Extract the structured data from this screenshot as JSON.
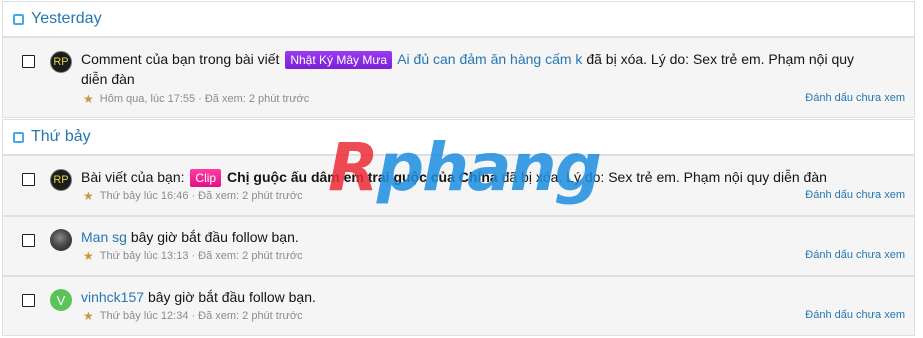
{
  "sections": [
    {
      "title": "Yesterday",
      "alerts": [
        {
          "avatar": "RP",
          "avatar_type": "rp",
          "prefix": "Comment của bạn trong bài viết",
          "label": "Nhật Ký Mây Mưa",
          "label_style": "purple",
          "thread_title": "Ai đủ can đảm ăn hàng cấm k",
          "suffix": "đã bị xóa. Lý do: Sex trẻ em. Phạm nội quy diễn đàn",
          "time": "Hôm qua, lúc 17:55",
          "viewed": "Đã xem: 2 phút trước",
          "mark_label": "Đánh dấu chưa xem"
        }
      ]
    },
    {
      "title": "Thứ bảy",
      "alerts": [
        {
          "avatar": "RP",
          "avatar_type": "rp",
          "prefix": "Bài viết của bạn:",
          "label": "Clip",
          "label_style": "pink",
          "thread_title": "Chị guộc ấu dâm em trai guộc của China",
          "suffix": "đã bị xóa. Lý do: Sex trẻ em. Phạm nội quy diễn đàn",
          "time": "Thứ bảy lúc 16:46",
          "viewed": "Đã xem: 2 phút trước",
          "mark_label": "Đánh dấu chưa xem"
        },
        {
          "avatar": "",
          "avatar_type": "photo",
          "user": "Man sg",
          "action": "bây giờ bắt đầu follow bạn.",
          "time": "Thứ bảy lúc 13:13",
          "viewed": "Đã xem: 2 phút trước",
          "mark_label": "Đánh dấu chưa xem"
        },
        {
          "avatar": "V",
          "avatar_type": "letter",
          "user": "vinhck157",
          "action": "bây giờ bắt đầu follow bạn.",
          "time": "Thứ bảy lúc 12:34",
          "viewed": "Đã xem: 2 phút trước",
          "mark_label": "Đánh dấu chưa xem"
        }
      ]
    }
  ],
  "meta_separator": "·",
  "icons": {
    "star": "star-icon",
    "checkbox": "checkbox-icon"
  },
  "colors": {
    "link": "#2577b1",
    "meta": "#8c8c8c",
    "star": "#c69a3a",
    "row_bg": "#f5f5f5"
  },
  "watermark": {
    "part1": "R",
    "part2": "phang"
  }
}
